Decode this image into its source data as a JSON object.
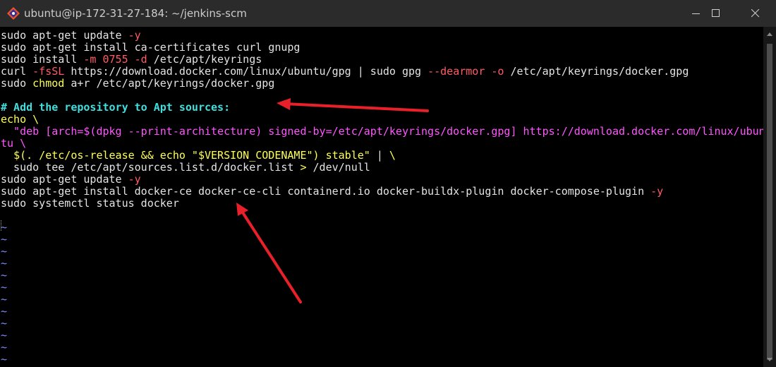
{
  "window": {
    "title": "ubuntu@ip-172-31-27-184: ~/jenkins-scm",
    "controls": {
      "minimize": "minimize-icon",
      "maximize": "maximize-icon",
      "close": "close-icon"
    }
  },
  "colors": {
    "background": "#000000",
    "text": "#e4e4e4",
    "flag": "#ff5c63",
    "keyword": "#ffff55",
    "comment": "#42dede",
    "string": "#ff55ff",
    "tilde": "#7b8cff",
    "annotation_arrow": "#e8202a"
  },
  "terminal": {
    "lines": [
      [
        {
          "t": "sudo apt-get update ",
          "c": "white"
        },
        {
          "t": "-y",
          "c": "red"
        }
      ],
      [
        {
          "t": "sudo apt-get install ca-certificates curl gnupg",
          "c": "white"
        }
      ],
      [
        {
          "t": "sudo install ",
          "c": "white"
        },
        {
          "t": "-m",
          "c": "red"
        },
        {
          "t": " ",
          "c": "white"
        },
        {
          "t": "0755",
          "c": "red"
        },
        {
          "t": " ",
          "c": "white"
        },
        {
          "t": "-d",
          "c": "red"
        },
        {
          "t": " /etc/apt/keyrings",
          "c": "white"
        }
      ],
      [
        {
          "t": "curl ",
          "c": "white"
        },
        {
          "t": "-fsSL",
          "c": "red"
        },
        {
          "t": " https://download.docker.com/linux/ubuntu/gpg | sudo gpg ",
          "c": "white"
        },
        {
          "t": "--dearmor",
          "c": "red"
        },
        {
          "t": " ",
          "c": "white"
        },
        {
          "t": "-o",
          "c": "red"
        },
        {
          "t": " /etc/apt/keyrings/docker.gpg",
          "c": "white"
        }
      ],
      [
        {
          "t": "sudo ",
          "c": "white"
        },
        {
          "t": "chmod",
          "c": "yellow"
        },
        {
          "t": " a+r /etc/apt/keyrings/docker.gpg",
          "c": "white"
        }
      ],
      [
        {
          "t": "",
          "c": "white"
        }
      ],
      [
        {
          "t": "# Add the repository to Apt sources:",
          "c": "comment"
        }
      ],
      [
        {
          "t": "echo \\",
          "c": "yellow"
        }
      ],
      [
        {
          "t": "  \"deb [arch=$(dpkg --print-architecture) signed-by=/etc/apt/keyrings/docker.gpg] https://download.docker.com/linux/ubun",
          "c": "purple"
        }
      ],
      [
        {
          "t": "tu \\",
          "c": "purple"
        }
      ],
      [
        {
          "t": "  ",
          "c": "white"
        },
        {
          "t": "$(. /etc/os-release && ",
          "c": "yellow"
        },
        {
          "t": "echo",
          "c": "yellow"
        },
        {
          "t": " \"$VERSION_CODENAME\") stable\"",
          "c": "yellow"
        },
        {
          "t": " | ",
          "c": "white"
        },
        {
          "t": "\\",
          "c": "yellow"
        }
      ],
      [
        {
          "t": "  sudo tee /etc/apt/sources.list.d/docker.list ",
          "c": "white"
        },
        {
          "t": ">",
          "c": "yellow"
        },
        {
          "t": " /dev/null",
          "c": "white"
        }
      ],
      [
        {
          "t": "sudo apt-get update ",
          "c": "white"
        },
        {
          "t": "-y",
          "c": "red"
        }
      ],
      [
        {
          "t": "sudo apt-get install docker-ce docker-ce-cli containerd.io docker-buildx-plugin docker-compose-plugin ",
          "c": "white"
        },
        {
          "t": "-y",
          "c": "red"
        }
      ],
      [
        {
          "t": "sudo systemctl status docker",
          "c": "white"
        }
      ],
      [
        {
          "t": "",
          "c": "white"
        }
      ],
      [
        {
          "t": "~",
          "c": "tilde"
        }
      ],
      [
        {
          "t": "~",
          "c": "tilde"
        }
      ],
      [
        {
          "t": "~",
          "c": "tilde"
        }
      ],
      [
        {
          "t": "~",
          "c": "tilde"
        }
      ],
      [
        {
          "t": "~",
          "c": "tilde"
        }
      ],
      [
        {
          "t": "~",
          "c": "tilde"
        }
      ],
      [
        {
          "t": "~",
          "c": "tilde"
        }
      ],
      [
        {
          "t": "~",
          "c": "tilde"
        }
      ],
      [
        {
          "t": "~",
          "c": "tilde"
        }
      ],
      [
        {
          "t": "~",
          "c": "tilde"
        }
      ],
      [
        {
          "t": "~",
          "c": "tilde"
        }
      ],
      [
        {
          "t": "~",
          "c": "tilde"
        }
      ]
    ]
  },
  "annotations": {
    "arrows": 2
  }
}
